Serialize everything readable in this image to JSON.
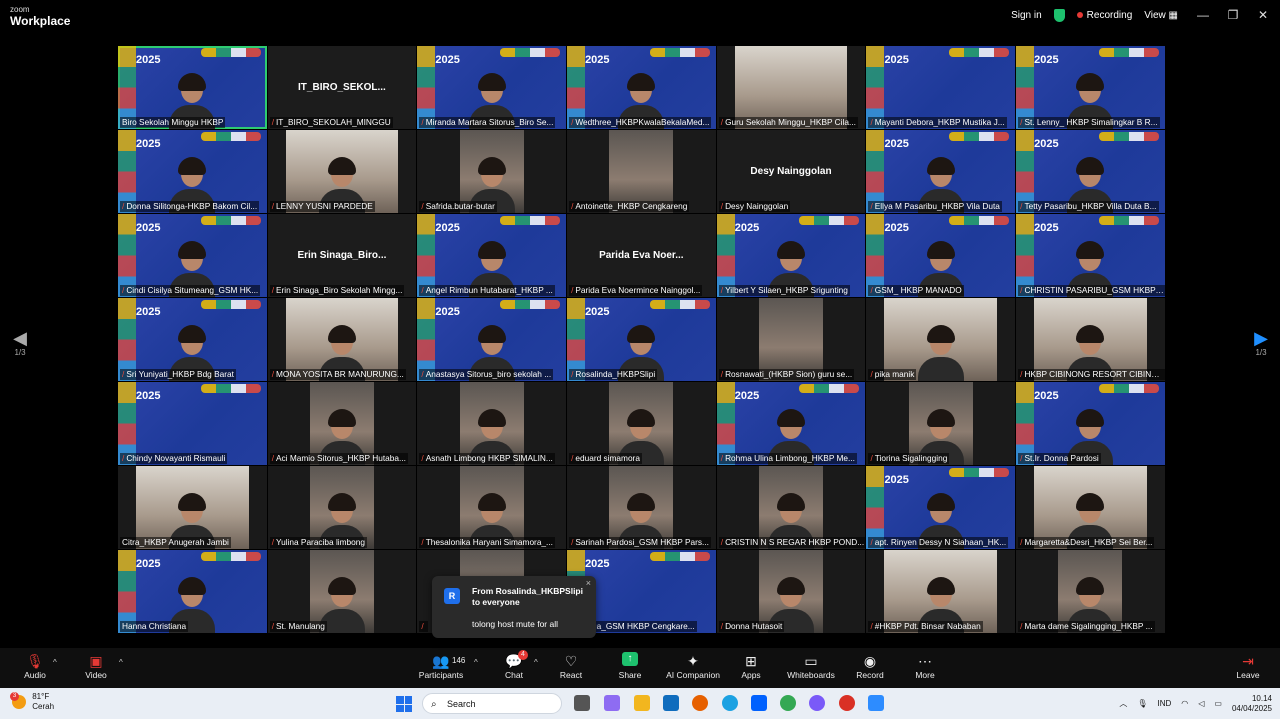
{
  "app": {
    "brand_top": "zoom",
    "brand_bottom": "Workplace"
  },
  "titlebar": {
    "sign_in": "Sign in",
    "recording": "Recording",
    "view": "View"
  },
  "pager": {
    "left": "1/3",
    "right": "1/3"
  },
  "tiles": [
    {
      "name": "Biro Sekolah Minggu HKBP",
      "style": "bg",
      "active": true,
      "mic": false,
      "person": true
    },
    {
      "name": "IT_BIRO_SEKOLAH_MINGGU",
      "style": "dark",
      "big": "IT_BIRO_SEKOL...",
      "mic": true
    },
    {
      "name": "Miranda Martara Sitorus_Biro Se...",
      "style": "bg",
      "mic": true,
      "person": true
    },
    {
      "name": "Wedthree_HKBPKwalaBekalaMed...",
      "style": "bg",
      "mic": true,
      "person": true
    },
    {
      "name": "Guru Sekolah Minggu_HKBP Cila...",
      "style": "wide",
      "mic": true
    },
    {
      "name": "Mayanti Debora_HKBP Mustika J...",
      "style": "bg",
      "mic": true
    },
    {
      "name": "St. Lenny_ HKBP Simalingkar B R...",
      "style": "bg",
      "mic": true,
      "person": true
    },
    {
      "name": "Donna Silitonga-HKBP Bakom Cil...",
      "style": "bg",
      "mic": true,
      "person": true
    },
    {
      "name": "LENNY YUSNI PARDEDE",
      "style": "wide",
      "mic": true,
      "person": true
    },
    {
      "name": "Safrida.butar-butar",
      "style": "photo",
      "mic": true,
      "person": true
    },
    {
      "name": "Antoinette_HKBP Cengkareng",
      "style": "photo",
      "mic": true
    },
    {
      "name": "Desy Nainggolan",
      "style": "dark",
      "big": "Desy Nainggolan",
      "mic": true
    },
    {
      "name": "Ellya M Pasaribu_HKBP Vila Duta",
      "style": "bg",
      "mic": true,
      "person": true
    },
    {
      "name": "Tetty Pasaribu_HKBP Villa Duta B...",
      "style": "bg",
      "mic": true,
      "person": true
    },
    {
      "name": "Cindi Cisilya Situmeang_GSM HK...",
      "style": "bg",
      "mic": true,
      "person": true
    },
    {
      "name": "Erin Sinaga_Biro Sekolah Mingg...",
      "style": "dark",
      "big": "Erin  Sinaga_Biro...",
      "mic": true
    },
    {
      "name": "Angel Rimbun Hutabarat_HKBP ...",
      "style": "bg",
      "mic": true,
      "person": true
    },
    {
      "name": "Parida Eva Noermince Nainggol...",
      "style": "dark",
      "big": "Parida  Eva  Noer...",
      "mic": true
    },
    {
      "name": "Yilbert Y Silaen_HKBP Srigunting",
      "style": "bg",
      "mic": true,
      "person": true
    },
    {
      "name": "GSM_ HKBP MANADO",
      "style": "bg",
      "mic": true,
      "person": true
    },
    {
      "name": "CHRISTIN PASARIBU_GSM HKBP ...",
      "style": "bg",
      "mic": true,
      "person": true
    },
    {
      "name": "Sri Yuniyati_HKBP Bdg Barat",
      "style": "bg",
      "mic": true,
      "person": true
    },
    {
      "name": "MONA YOSITA BR MANURUNG...",
      "style": "wide",
      "mic": true,
      "person": true
    },
    {
      "name": "Anastasya Sitorus_biro sekolah ...",
      "style": "bg",
      "mic": true,
      "person": true
    },
    {
      "name": "Rosalinda_HKBPSlipi",
      "style": "bg",
      "mic": true,
      "person": true
    },
    {
      "name": "Rosnawati_(HKBP Sion) guru se...",
      "style": "photo",
      "mic": true
    },
    {
      "name": "pika manik",
      "style": "wide",
      "mic": true,
      "person": true
    },
    {
      "name": "HKBP CIBINONG RESORT CIBINO...",
      "style": "wide",
      "mic": true,
      "person": true
    },
    {
      "name": "Chindy Novayanti Rismauli",
      "style": "bg",
      "mic": true
    },
    {
      "name": "Aci Mamio Sitorus_HKBP Hutaba...",
      "style": "photo",
      "mic": true,
      "person": true
    },
    {
      "name": "Asnath Limbong HKBP SIMALIN...",
      "style": "photo",
      "mic": true,
      "person": true
    },
    {
      "name": "eduard simamora",
      "style": "photo",
      "mic": true,
      "person": true
    },
    {
      "name": "Rohma Ulina Limbong_HKBP Me...",
      "style": "bg",
      "mic": true,
      "person": true
    },
    {
      "name": "Tiorina Sigalingging",
      "style": "photo",
      "mic": true,
      "person": true
    },
    {
      "name": "St.Ir. Donna Pardosi",
      "style": "bg",
      "mic": true,
      "person": true
    },
    {
      "name": "Citra_HKBP Anugerah Jambi",
      "style": "wide",
      "mic": false,
      "person": true
    },
    {
      "name": "Yulina Paraciba limbong",
      "style": "photo",
      "mic": true,
      "person": true
    },
    {
      "name": "Thesalonika Haryani Simamora_...",
      "style": "photo",
      "mic": true,
      "person": true
    },
    {
      "name": "Sarinah Pardosi_GSM HKBP Pars...",
      "style": "photo",
      "mic": true,
      "person": true
    },
    {
      "name": "CRISTIN N S REGAR HKBP POND...",
      "style": "photo",
      "mic": true,
      "person": true
    },
    {
      "name": "apt. Rinyen Dessy N Siahaan_HK...",
      "style": "bg",
      "mic": true,
      "person": true
    },
    {
      "name": "Margaretta&Desri_HKBP Sei Ber...",
      "style": "wide",
      "mic": true,
      "person": true
    },
    {
      "name": "Hanna Christiana",
      "style": "bg",
      "mic": false,
      "person": true
    },
    {
      "name": "St. Manulang",
      "style": "photo",
      "mic": true,
      "person": true
    },
    {
      "name": "",
      "style": "photo",
      "mic": true,
      "person": true
    },
    {
      "name": "Sinaga_GSM HKBP Cengkare...",
      "style": "bg",
      "mic": true
    },
    {
      "name": "Donna Hutasoit",
      "style": "photo",
      "mic": true,
      "person": true
    },
    {
      "name": "#HKBP Pdt. Binsar Nababan",
      "style": "wide",
      "mic": true,
      "person": true
    },
    {
      "name": "Marta dame Sigalingging_HKBP ...",
      "style": "photo",
      "mic": true,
      "person": true
    }
  ],
  "tile_year": "2025",
  "chat_toast": {
    "avatar": "R",
    "from": "From Rosalinda_HKBPSlipi to everyone",
    "message": "tolong host mute for all",
    "close": "×"
  },
  "toolbar": {
    "audio": "Audio",
    "video": "Video",
    "participants": "Participants",
    "participants_count": "146",
    "chat": "Chat",
    "chat_badge": "4",
    "react": "React",
    "share": "Share",
    "companion": "AI Companion",
    "apps": "Apps",
    "whiteboards": "Whiteboards",
    "record": "Record",
    "more": "More",
    "leave": "Leave"
  },
  "taskbar": {
    "weather_temp": "81°F",
    "weather_desc": "Cerah",
    "weather_badge": "3",
    "search": "Search",
    "lang": "IND",
    "time": "10.14",
    "date": "04/04/2025"
  },
  "colors": {
    "accent_green": "#1ec16e",
    "record_red": "#e53935",
    "tile_blue": "#2c43a8"
  }
}
